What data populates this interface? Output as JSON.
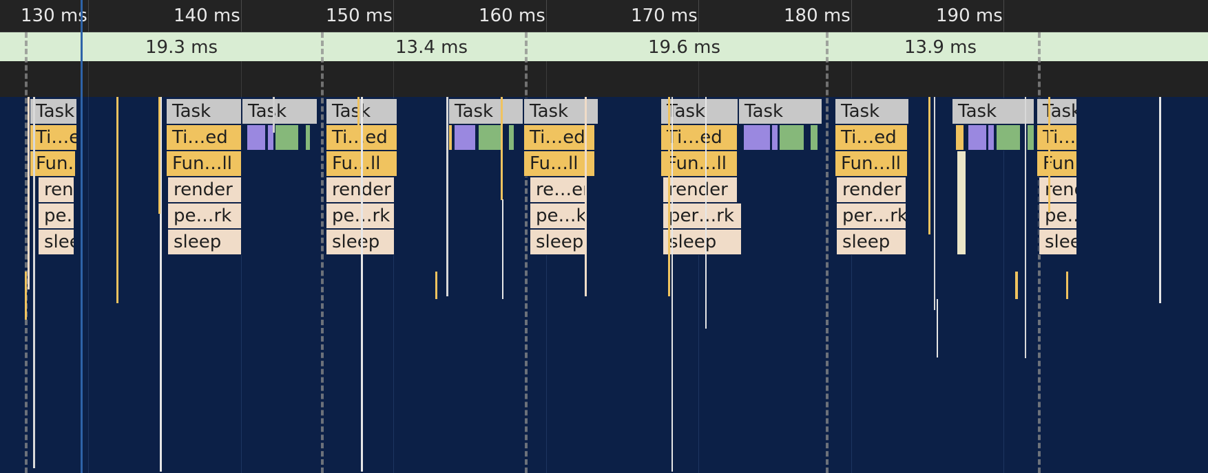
{
  "ruler": {
    "ticks": [
      {
        "label": "130 ms",
        "at": 130
      },
      {
        "label": "140 ms",
        "at": 140
      },
      {
        "label": "150 ms",
        "at": 150
      },
      {
        "label": "160 ms",
        "at": 160
      },
      {
        "label": "170 ms",
        "at": 170
      },
      {
        "label": "180 ms",
        "at": 180
      },
      {
        "label": "190 ms",
        "at": 190
      }
    ]
  },
  "frames": [
    {
      "label": "19.3 ms",
      "start_ms": 128.1,
      "end_ms": 147.5
    },
    {
      "label": "13.4 ms",
      "start_ms": 147.5,
      "end_ms": 160.9
    },
    {
      "label": "19.6 ms",
      "start_ms": 160.9,
      "end_ms": 180.6
    },
    {
      "label": "13.9 ms",
      "start_ms": 180.6,
      "end_ms": 194.5
    }
  ],
  "playhead_ms": 131.7,
  "colors": {
    "task": "#c8c8c8",
    "timer_fired": "#f0c35f",
    "function_call": "#f0c35f",
    "js_frame": "#f0dcc8",
    "paint": "#9a88e0",
    "composite": "#86b87a"
  },
  "entries": [
    {
      "label": "Task",
      "kind": "task",
      "start_ms": 128.35,
      "end_ms": 131.45,
      "depth": 0
    },
    {
      "label": "Ti…ed",
      "kind": "timer_fired",
      "start_ms": 128.35,
      "end_ms": 131.45,
      "depth": 1
    },
    {
      "label": "Fun…ll",
      "kind": "function_call",
      "start_ms": 128.35,
      "end_ms": 131.35,
      "depth": 2
    },
    {
      "label": "render",
      "kind": "js_frame",
      "start_ms": 128.85,
      "end_ms": 131.25,
      "depth": 3
    },
    {
      "label": "pe…rk",
      "kind": "js_frame",
      "start_ms": 128.85,
      "end_ms": 131.25,
      "depth": 4
    },
    {
      "label": "sleep",
      "kind": "js_frame",
      "start_ms": 128.85,
      "end_ms": 131.25,
      "depth": 5
    },
    {
      "label": "Task",
      "kind": "task",
      "start_ms": 137.25,
      "end_ms": 142.25,
      "depth": 0
    },
    {
      "label": "Ti…ed",
      "kind": "timer_fired",
      "start_ms": 137.25,
      "end_ms": 142.25,
      "depth": 1
    },
    {
      "label": "Fun…ll",
      "kind": "function_call",
      "start_ms": 137.25,
      "end_ms": 142.25,
      "depth": 2
    },
    {
      "label": "render",
      "kind": "js_frame",
      "start_ms": 137.35,
      "end_ms": 142.25,
      "depth": 3
    },
    {
      "label": "pe…rk",
      "kind": "js_frame",
      "start_ms": 137.35,
      "end_ms": 142.25,
      "depth": 4
    },
    {
      "label": "sleep",
      "kind": "js_frame",
      "start_ms": 137.35,
      "end_ms": 142.25,
      "depth": 5
    },
    {
      "label": "Task",
      "kind": "task",
      "start_ms": 142.25,
      "end_ms": 147.2,
      "depth": 0
    },
    {
      "label": "Task",
      "kind": "task",
      "start_ms": 147.75,
      "end_ms": 152.45,
      "depth": 0
    },
    {
      "label": "Ti…ed",
      "kind": "timer_fired",
      "start_ms": 147.75,
      "end_ms": 152.45,
      "depth": 1
    },
    {
      "label": "Fu…ll",
      "kind": "function_call",
      "start_ms": 147.75,
      "end_ms": 152.45,
      "depth": 2
    },
    {
      "label": "render",
      "kind": "js_frame",
      "start_ms": 147.75,
      "end_ms": 152.25,
      "depth": 3
    },
    {
      "label": "pe…rk",
      "kind": "js_frame",
      "start_ms": 147.75,
      "end_ms": 152.25,
      "depth": 4
    },
    {
      "label": "sleep",
      "kind": "js_frame",
      "start_ms": 147.75,
      "end_ms": 152.25,
      "depth": 5
    },
    {
      "label": "Task",
      "kind": "task",
      "start_ms": 155.8,
      "end_ms": 160.7,
      "depth": 0
    },
    {
      "label": "Task",
      "kind": "task",
      "start_ms": 160.7,
      "end_ms": 165.6,
      "depth": 0
    },
    {
      "label": "Ti…ed",
      "kind": "timer_fired",
      "start_ms": 160.7,
      "end_ms": 165.4,
      "depth": 1
    },
    {
      "label": "Fu…ll",
      "kind": "function_call",
      "start_ms": 160.7,
      "end_ms": 165.4,
      "depth": 2
    },
    {
      "label": "re…er",
      "kind": "js_frame",
      "start_ms": 161.1,
      "end_ms": 164.9,
      "depth": 3
    },
    {
      "label": "pe…k",
      "kind": "js_frame",
      "start_ms": 161.1,
      "end_ms": 164.9,
      "depth": 4
    },
    {
      "label": "sleep",
      "kind": "js_frame",
      "start_ms": 161.1,
      "end_ms": 164.9,
      "depth": 5
    },
    {
      "label": "Task",
      "kind": "task",
      "start_ms": 169.7,
      "end_ms": 174.8,
      "depth": 0
    },
    {
      "label": "Ti…ed",
      "kind": "timer_fired",
      "start_ms": 169.7,
      "end_ms": 174.75,
      "depth": 1
    },
    {
      "label": "Fun…ll",
      "kind": "function_call",
      "start_ms": 169.7,
      "end_ms": 174.75,
      "depth": 2
    },
    {
      "label": "render",
      "kind": "js_frame",
      "start_ms": 169.8,
      "end_ms": 174.75,
      "depth": 3
    },
    {
      "label": "per…rk",
      "kind": "js_frame",
      "start_ms": 169.8,
      "end_ms": 175.0,
      "depth": 4
    },
    {
      "label": "sleep",
      "kind": "js_frame",
      "start_ms": 169.8,
      "end_ms": 175.0,
      "depth": 5
    },
    {
      "label": "Task",
      "kind": "task",
      "start_ms": 174.8,
      "end_ms": 180.3,
      "depth": 0
    },
    {
      "label": "Task",
      "kind": "task",
      "start_ms": 181.1,
      "end_ms": 186.0,
      "depth": 0
    },
    {
      "label": "Ti…ed",
      "kind": "timer_fired",
      "start_ms": 181.1,
      "end_ms": 185.9,
      "depth": 1
    },
    {
      "label": "Fun…ll",
      "kind": "function_call",
      "start_ms": 181.1,
      "end_ms": 185.9,
      "depth": 2
    },
    {
      "label": "render",
      "kind": "js_frame",
      "start_ms": 181.2,
      "end_ms": 185.8,
      "depth": 3
    },
    {
      "label": "per…rk",
      "kind": "js_frame",
      "start_ms": 181.2,
      "end_ms": 185.8,
      "depth": 4
    },
    {
      "label": "sleep",
      "kind": "js_frame",
      "start_ms": 181.2,
      "end_ms": 185.8,
      "depth": 5
    },
    {
      "label": "Task",
      "kind": "task",
      "start_ms": 188.8,
      "end_ms": 194.2,
      "depth": 0
    },
    {
      "label": "Task",
      "kind": "task",
      "start_ms": 194.35,
      "end_ms": 197.0,
      "depth": 0
    },
    {
      "label": "Ti…d",
      "kind": "timer_fired",
      "start_ms": 194.35,
      "end_ms": 197.0,
      "depth": 1
    },
    {
      "label": "Fun…ll",
      "kind": "function_call",
      "start_ms": 194.35,
      "end_ms": 197.0,
      "depth": 2
    },
    {
      "label": "render",
      "kind": "js_frame",
      "start_ms": 194.45,
      "end_ms": 197.0,
      "depth": 3
    },
    {
      "label": "pe…rk",
      "kind": "js_frame",
      "start_ms": 194.45,
      "end_ms": 197.0,
      "depth": 4
    },
    {
      "label": "sleep",
      "kind": "js_frame",
      "start_ms": 194.45,
      "end_ms": 197.0,
      "depth": 5
    }
  ],
  "paint_slices": [
    {
      "kind": "composite",
      "start_ms": 124.0,
      "end_ms": 124.4
    },
    {
      "kind": "composite",
      "start_ms": 124.9,
      "end_ms": 125.3
    },
    {
      "kind": "paint",
      "start_ms": 142.55,
      "end_ms": 143.8
    },
    {
      "kind": "paint",
      "start_ms": 143.9,
      "end_ms": 144.35
    },
    {
      "kind": "composite",
      "start_ms": 144.4,
      "end_ms": 146.0
    },
    {
      "kind": "composite",
      "start_ms": 146.4,
      "end_ms": 146.75
    },
    {
      "kind": "timer_fired",
      "start_ms": 155.8,
      "end_ms": 156.05
    },
    {
      "kind": "paint",
      "start_ms": 156.15,
      "end_ms": 157.6
    },
    {
      "kind": "composite",
      "start_ms": 157.7,
      "end_ms": 159.3
    },
    {
      "kind": "composite",
      "start_ms": 159.7,
      "end_ms": 160.1
    },
    {
      "kind": "paint",
      "start_ms": 175.1,
      "end_ms": 176.9
    },
    {
      "kind": "paint",
      "start_ms": 176.95,
      "end_ms": 177.4
    },
    {
      "kind": "composite",
      "start_ms": 177.45,
      "end_ms": 179.1
    },
    {
      "kind": "composite",
      "start_ms": 179.5,
      "end_ms": 180.0
    },
    {
      "kind": "timer_fired",
      "start_ms": 189.0,
      "end_ms": 189.6
    },
    {
      "kind": "paint",
      "start_ms": 189.8,
      "end_ms": 191.1
    },
    {
      "kind": "paint",
      "start_ms": 191.15,
      "end_ms": 191.6
    },
    {
      "kind": "composite",
      "start_ms": 191.65,
      "end_ms": 193.3
    },
    {
      "kind": "composite",
      "start_ms": 193.7,
      "end_ms": 194.2
    }
  ],
  "thin_slices": [
    {
      "kind": "js_frame",
      "at_ms": 189.1,
      "from_depth": 2,
      "to_depth": 5
    }
  ]
}
